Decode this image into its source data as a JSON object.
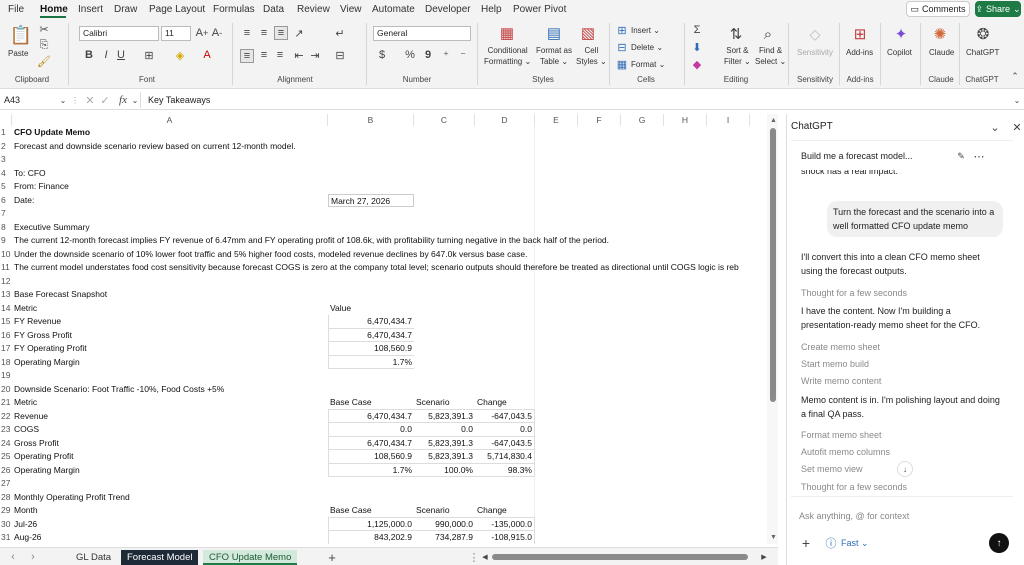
{
  "menu": {
    "items": [
      "File",
      "Home",
      "Insert",
      "Draw",
      "Page Layout",
      "Formulas",
      "Data",
      "Review",
      "View",
      "Automate",
      "Developer",
      "Help",
      "Power Pivot"
    ],
    "comments": "Comments",
    "share": "Share"
  },
  "ribbon": {
    "paste": "Paste",
    "clipboard": "Clipboard",
    "font_name": "Calibri",
    "font_size": "11",
    "font": "Font",
    "alignment": "Alignment",
    "number_format": "General",
    "number": "Number",
    "conditional": "Conditional",
    "formatting": "Formatting",
    "format_as": "Format as",
    "table": "Table",
    "cell": "Cell",
    "cell_styles": "Styles",
    "styles": "Styles",
    "insert": "Insert",
    "delete": "Delete",
    "format": "Format",
    "cells": "Cells",
    "sort": "Sort &",
    "filter": "Filter",
    "find": "Find &",
    "select": "Select",
    "editing": "Editing",
    "sensitivity": "Sensitivity",
    "sensitivity_grp": "Sensitivity",
    "addins": "Add-ins",
    "addins_grp": "Add-ins",
    "copilot": "Copilot",
    "claude": "Claude",
    "claude_grp": "Claude",
    "chatgpt": "ChatGPT",
    "chatgpt_grp": "ChatGPT"
  },
  "formula_bar": {
    "name_box": "A43",
    "fx": "fx",
    "content": "Key Takeaways"
  },
  "grid": {
    "columns": [
      "A",
      "B",
      "C",
      "D",
      "E",
      "F",
      "G",
      "H",
      "I"
    ],
    "rows": [
      {
        "n": "1",
        "a": "CFO Update Memo",
        "bold": true
      },
      {
        "n": "2",
        "a": "Forecast and downside scenario review based on current 12-month model."
      },
      {
        "n": "3",
        "a": ""
      },
      {
        "n": "4",
        "a": "To: CFO"
      },
      {
        "n": "5",
        "a": "From: Finance"
      },
      {
        "n": "6",
        "a": "Date:",
        "b": "March 27, 2026",
        "b_left": true
      },
      {
        "n": "7",
        "a": ""
      },
      {
        "n": "8",
        "a": "Executive Summary"
      },
      {
        "n": "9",
        "a": "The current 12-month forecast implies FY revenue of 6.47mm and FY operating profit of 108.6k, with profitability turning negative in the back half of the period."
      },
      {
        "n": "10",
        "a": "Under the downside scenario of 10% lower foot traffic and 5% higher food costs, modeled revenue declines by 647.0k versus base case."
      },
      {
        "n": "11",
        "a": "The current model understates food cost sensitivity because forecast COGS is zero at the company total level; scenario outputs should therefore be treated as directional until COGS logic is reb"
      },
      {
        "n": "12",
        "a": ""
      },
      {
        "n": "13",
        "a": "Base Forecast Snapshot"
      },
      {
        "n": "14",
        "a": "Metric",
        "b": "Value",
        "b_left": true
      },
      {
        "n": "15",
        "a": "FY Revenue",
        "b": "6,470,434.7"
      },
      {
        "n": "16",
        "a": "FY Gross Profit",
        "b": "6,470,434.7"
      },
      {
        "n": "17",
        "a": "FY Operating Profit",
        "b": "108,560.9"
      },
      {
        "n": "18",
        "a": "Operating Margin",
        "b": "1.7%"
      },
      {
        "n": "19",
        "a": ""
      },
      {
        "n": "20",
        "a": "Downside Scenario: Foot Traffic -10%, Food Costs +5%"
      },
      {
        "n": "21",
        "a": "Metric",
        "b": "Base Case",
        "c": "Scenario",
        "d": "Change",
        "hdr": true
      },
      {
        "n": "22",
        "a": "Revenue",
        "b": "6,470,434.7",
        "c": "5,823,391.3",
        "d": "-647,043.5"
      },
      {
        "n": "23",
        "a": "COGS",
        "b": "0.0",
        "c": "0.0",
        "d": "0.0"
      },
      {
        "n": "24",
        "a": "Gross Profit",
        "b": "6,470,434.7",
        "c": "5,823,391.3",
        "d": "-647,043.5"
      },
      {
        "n": "25",
        "a": "Operating Profit",
        "b": "108,560.9",
        "c": "5,823,391.3",
        "d": "5,714,830.4"
      },
      {
        "n": "26",
        "a": "Operating Margin",
        "b": "1.7%",
        "c": "100.0%",
        "d": "98.3%"
      },
      {
        "n": "27",
        "a": ""
      },
      {
        "n": "28",
        "a": "Monthly Operating Profit Trend"
      },
      {
        "n": "29",
        "a": "Month",
        "b": "Base Case",
        "c": "Scenario",
        "d": "Change",
        "hdr": true
      },
      {
        "n": "30",
        "a": "Jul-26",
        "b": "1,125,000.0",
        "c": "990,000.0",
        "d": "-135,000.0"
      },
      {
        "n": "31",
        "a": "Aug-26",
        "b": "843,202.9",
        "c": "734,287.9",
        "d": "-108,915.0"
      }
    ]
  },
  "tabs": [
    "GL Data",
    "Forecast Model",
    "CFO Update Memo"
  ],
  "chat": {
    "header": "ChatGPT",
    "thread_title": "Build me a forecast model...",
    "cut_line": "shock has a real impact.",
    "user_msg": "Turn the forecast and the scenario into a well formatted CFO update memo",
    "reply1": "I'll convert this into a clean CFO memo sheet using the forecast outputs.",
    "thought1": "Thought for a few seconds",
    "reply2": "I have the content. Now I'm building a presentation-ready memo sheet for the CFO.",
    "steps1": [
      "Create memo sheet",
      "Start memo build",
      "Write memo content"
    ],
    "reply3": "Memo content is in. I'm polishing layout and doing a final QA pass.",
    "steps2": [
      "Format memo sheet",
      "Autofit memo columns",
      "Set memo view"
    ],
    "thought2": "Thought for a few seconds",
    "input_placeholder": "Ask anything, @ for context",
    "mode": "Fast"
  }
}
